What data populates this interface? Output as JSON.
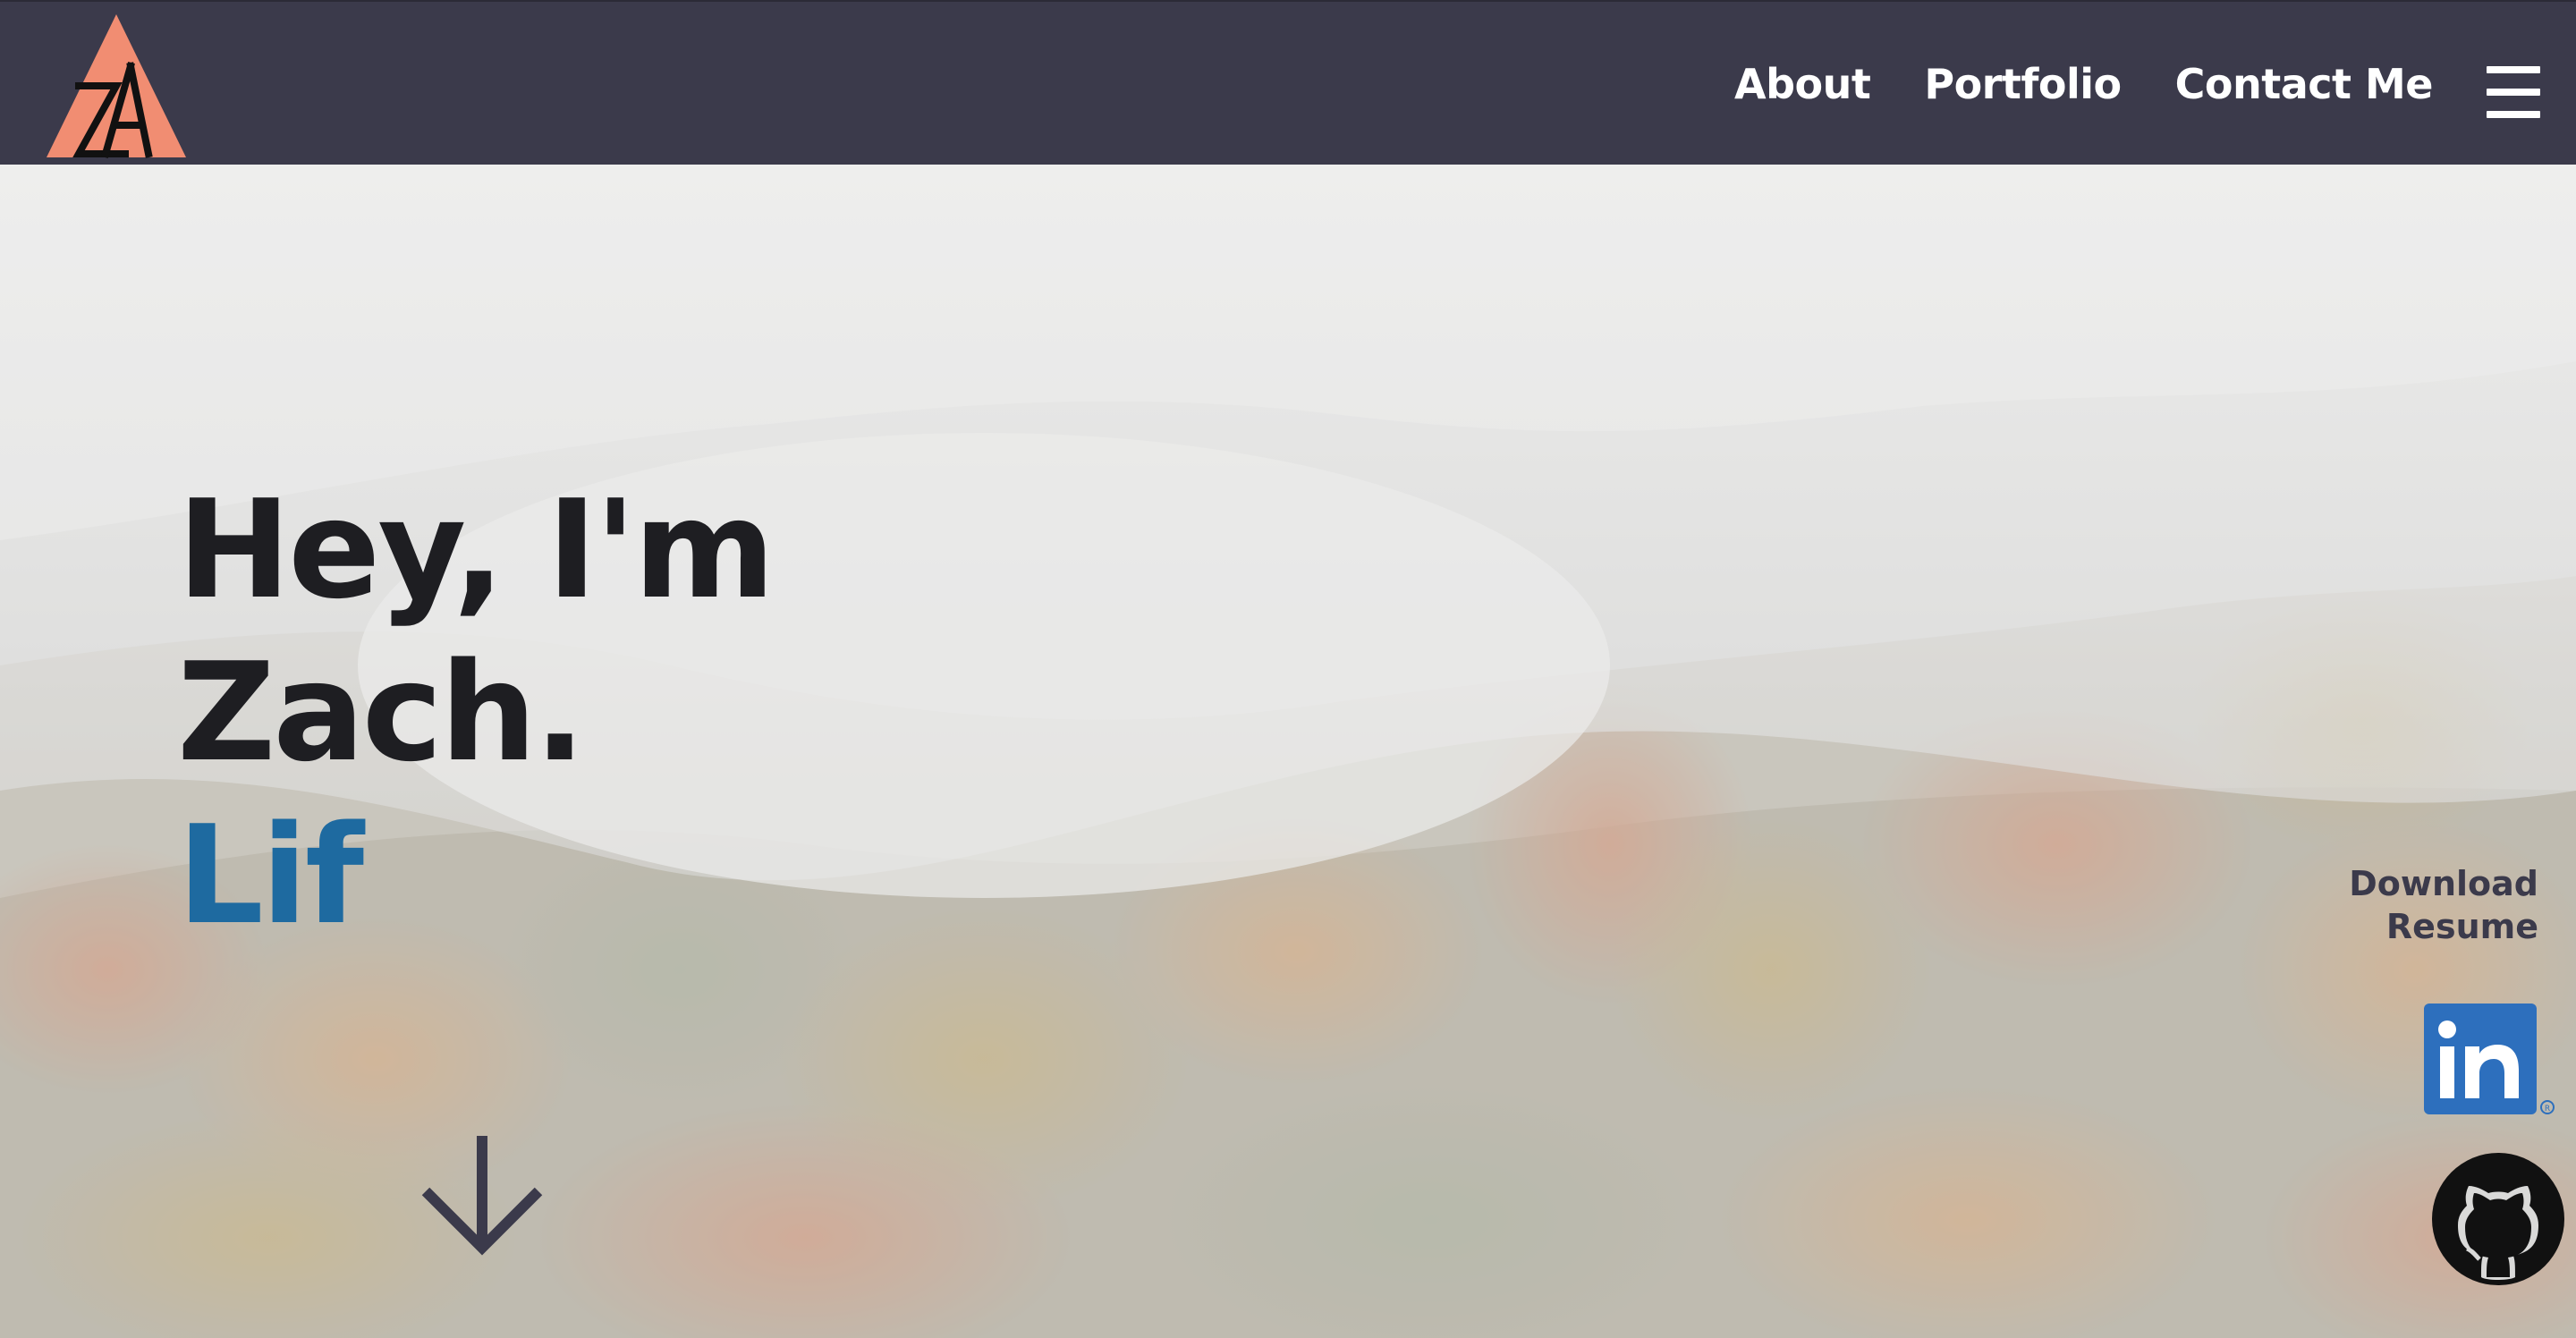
{
  "nav": {
    "logo_alt": "ZA logo",
    "links": [
      {
        "label": "About"
      },
      {
        "label": "Portfolio"
      },
      {
        "label": "Contact Me"
      }
    ],
    "menu_icon": "hamburger-menu-icon"
  },
  "hero": {
    "greeting_line1": "Hey, I'm",
    "greeting_line2": "Zach.",
    "typed_text": "Lif",
    "scroll_icon": "arrow-down-icon",
    "resume_label": "Download Resume",
    "linkedin_icon": "linkedin-icon",
    "github_icon": "github-icon"
  },
  "colors": {
    "nav_bg": "#3b3a4b",
    "logo_triangle": "#f18d72",
    "accent_text": "#1e6aa0",
    "headline_text": "#1e1e22",
    "linkedin_blue": "#2d6fbd"
  }
}
